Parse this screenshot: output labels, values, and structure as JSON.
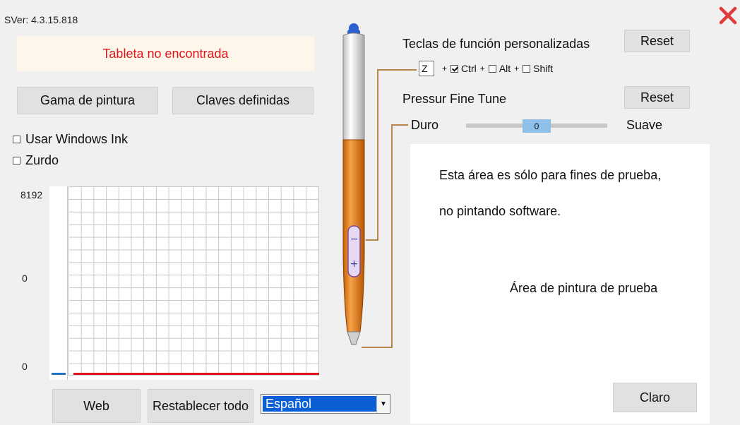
{
  "version": "SVer: 4.3.15.818",
  "status_text": "Tableta no encontrada",
  "buttons": {
    "paint_range": "Gama de pintura",
    "defined_keys": "Claves definidas",
    "reset_fkeys": "Reset",
    "reset_tune": "Reset",
    "web": "Web",
    "reset_all": "Restablecer todo",
    "clear": "Claro"
  },
  "options": {
    "windows_ink": "Usar Windows Ink",
    "left_handed": "Zurdo"
  },
  "graph": {
    "max_label": "8192",
    "mid_label": "0",
    "min_label": "0"
  },
  "function_keys": {
    "title": "Teclas de función personalizadas",
    "key": "Z",
    "ctrl": "Ctrl",
    "alt": "Alt",
    "shift": "Shift",
    "plus": "+"
  },
  "pressure": {
    "title": "Pressur Fine Tune",
    "hard": "Duro",
    "soft": "Suave",
    "value": "0"
  },
  "test_area": {
    "line1": "Esta área es sólo para fines de prueba,",
    "line2": "no pintando software.",
    "label": "Área de pintura de prueba"
  },
  "language": {
    "selected": "Español"
  },
  "colors": {
    "error_red": "#e0141c",
    "pen_orange": "#ef8a1c",
    "select_blue": "#0a5fd4"
  }
}
